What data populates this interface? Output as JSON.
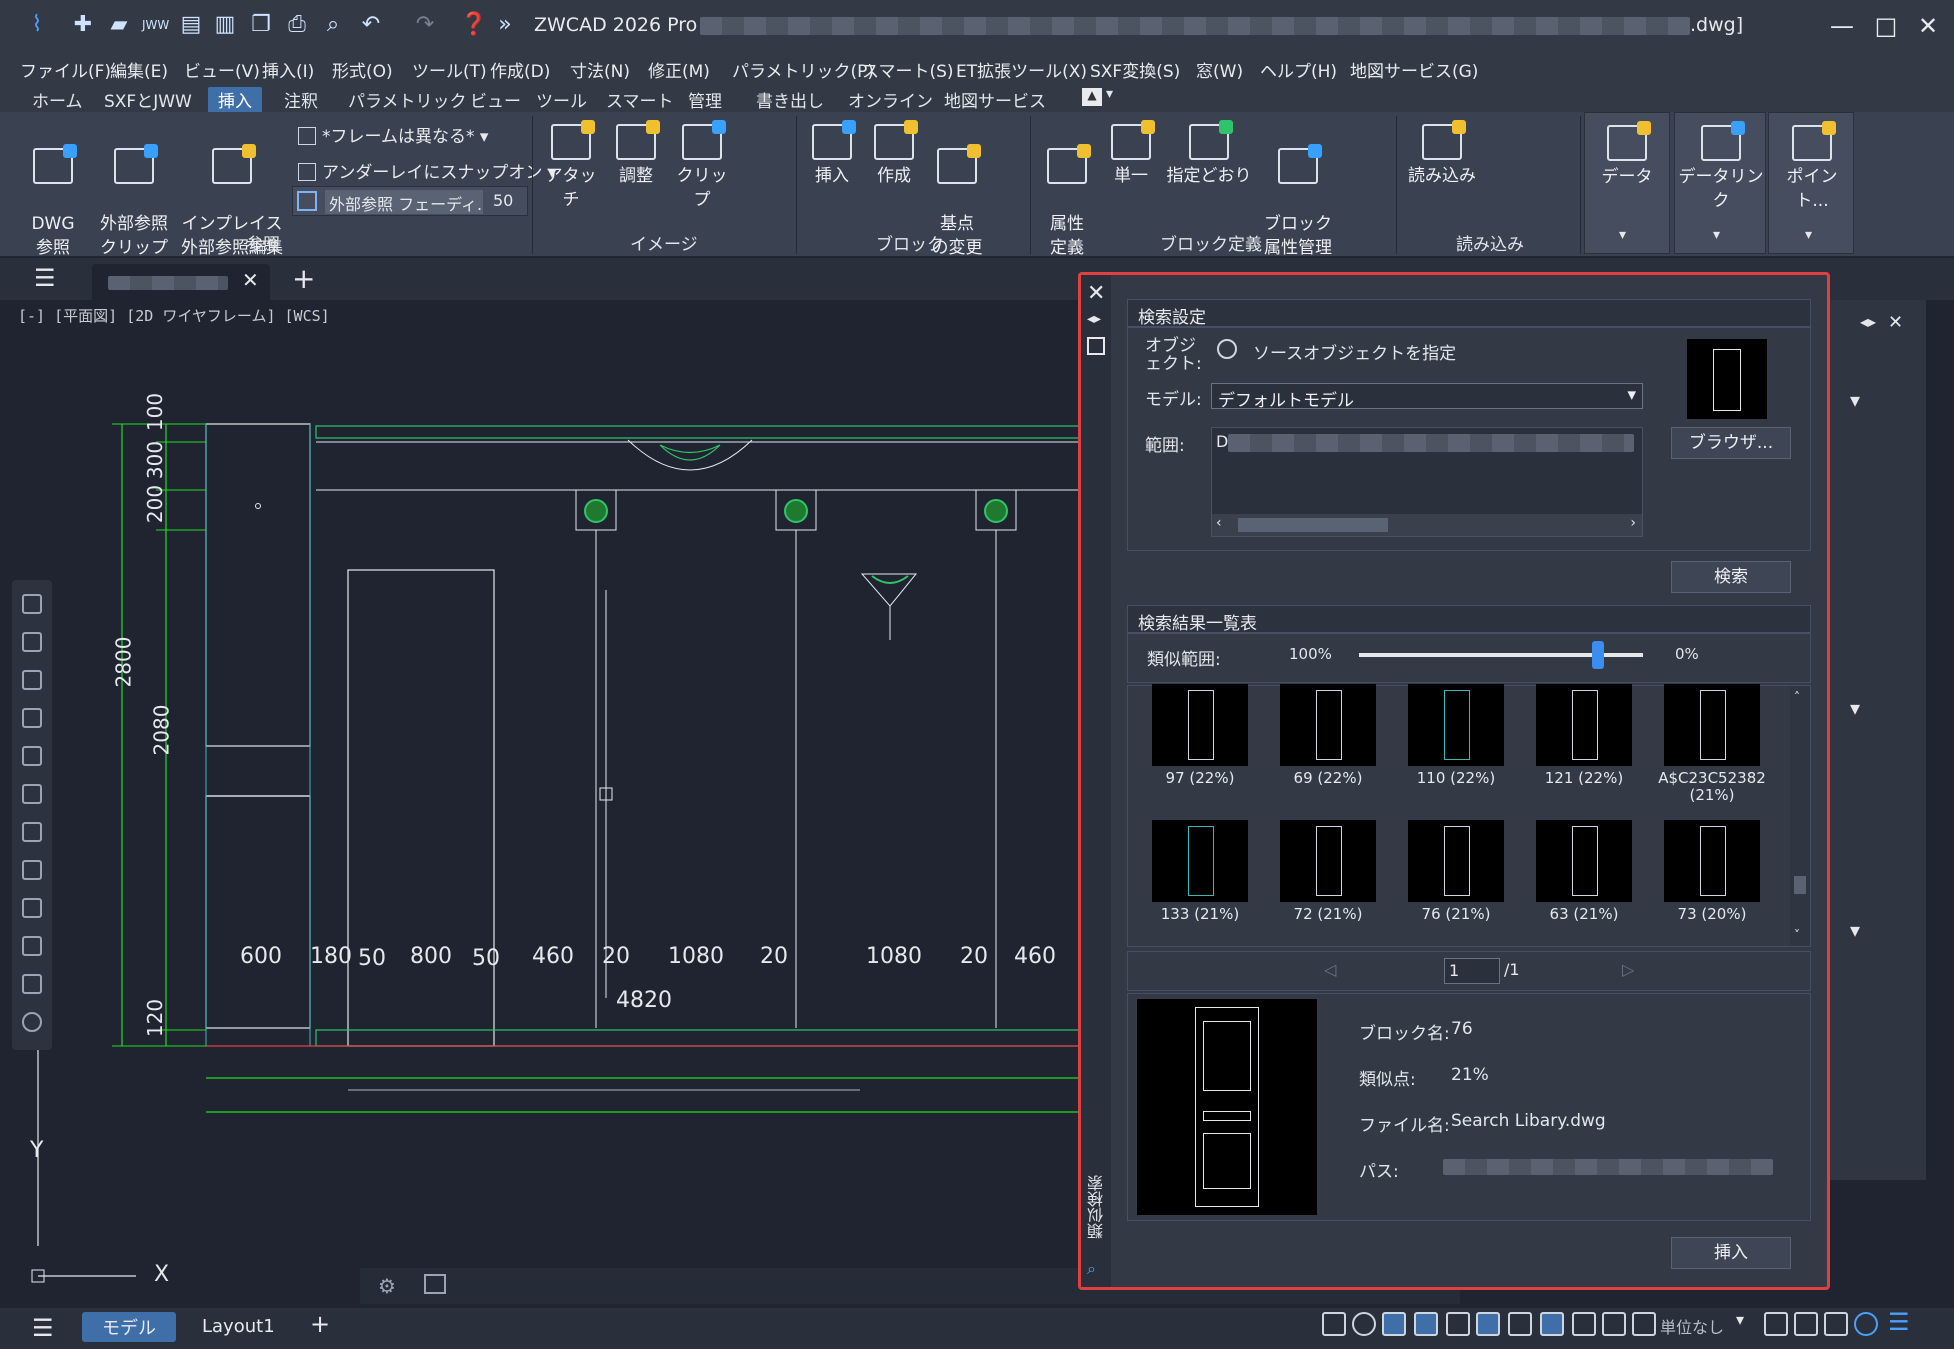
{
  "titlebar": {
    "app_title": "ZWCAD 2026 Pro - [",
    "file_suffix": ".dwg]",
    "minimize": "—",
    "maximize": "□",
    "close": "✕"
  },
  "menu": [
    "ファイル(F)",
    "編集(E)",
    "ビュー(V)",
    "挿入(I)",
    "形式(O)",
    "ツール(T)",
    "作成(D)",
    "寸法(N)",
    "修正(M)",
    "パラメトリック(P)",
    "スマート(S)",
    "ET拡張ツール(X)",
    "SXF変換(S)",
    "窓(W)",
    "ヘルプ(H)",
    "地図サービス(G)"
  ],
  "ribbon_tabs": [
    "ホーム",
    "SXFとJWW",
    "挿入",
    "注釈",
    "パラメトリック",
    "ビュー",
    "ツール",
    "スマート",
    "管理",
    "書き出し",
    "オンライン",
    "地図サービス"
  ],
  "ribbon_active_tab": "挿入",
  "ribbon": {
    "ref": {
      "dwg": "DWG\n参照",
      "xref_clip": "外部参照\nクリップ",
      "inplace_edit": "インプレイス\n外部参照編集",
      "frame_dropdown": "*フレームは異なる*",
      "underlay_snap": "アンダーレイにスナップオン",
      "xref_fade_label": "外部参照 フェーディ...",
      "xref_fade_value": "50",
      "panel_label": "参照"
    },
    "image": {
      "attach": "アタッチ",
      "adjust": "調整",
      "clip": "クリップ",
      "panel_label": "イメージ"
    },
    "block": {
      "insert": "挿入",
      "create": "作成",
      "basepoint": "基点\nの変更",
      "panel_label": "ブロック"
    },
    "block_def": {
      "attr_def": "属性\n定義",
      "single": "単一",
      "as_specified": "指定どおり",
      "block_attr_mgr": "ブロック\n属性管理",
      "panel_label": "ブロック定義"
    },
    "import": {
      "load": "読み込み",
      "panel_label": "読み込み"
    },
    "data": "データ",
    "data_link": "データリンク",
    "point": "ポイント..."
  },
  "viewport_label": "[-] [平面図] [2D ワイヤフレーム] [WCS]",
  "drawing": {
    "dim_vertical": [
      "100",
      "300",
      "200",
      "2800",
      "2080",
      "120"
    ],
    "dim_horizontal": [
      "600",
      "180",
      "50",
      "800",
      "50",
      "460",
      "20",
      "1080",
      "20",
      "1080",
      "20",
      "460"
    ],
    "total_width": "4820",
    "axis_y": "Y",
    "axis_x": "X"
  },
  "search_panel": {
    "vertical_title": "類似検索",
    "settings_header": "検索設定",
    "object_label": "オブジェクト:",
    "object_value": "ソースオブジェクトを指定",
    "model_label": "モデル:",
    "model_value": "デフォルトモデル",
    "range_label": "範囲:",
    "range_value": "D:",
    "browse_button": "ブラウザ...",
    "search_button": "検索",
    "results_header": "検索結果一覧表",
    "similarity_label": "類似範囲:",
    "similarity_max": "100%",
    "similarity_min": "0%",
    "similarity_value": 0.84,
    "results": [
      {
        "caption": "97 (22%)"
      },
      {
        "caption": "69 (22%)"
      },
      {
        "caption": "110 (22%)"
      },
      {
        "caption": "121 (22%)"
      },
      {
        "caption": "A$C23C52382\n(21%)"
      },
      {
        "caption": "133 (21%)"
      },
      {
        "caption": "72 (21%)"
      },
      {
        "caption": "76 (21%)"
      },
      {
        "caption": "63 (21%)"
      },
      {
        "caption": "73 (20%)"
      }
    ],
    "page_current": "1",
    "page_total": "/1",
    "detail": {
      "block_name_label": "ブロック名:",
      "block_name_value": "76",
      "similarity_label": "類似点:",
      "similarity_value": "21%",
      "file_label": "ファイル名:",
      "file_value": "Search Libary.dwg",
      "path_label": "パス:"
    },
    "insert_button": "挿入"
  },
  "layout_tabs": {
    "model": "モデル",
    "layout1": "Layout1",
    "add": "+"
  },
  "status": {
    "unit": "単位なし"
  },
  "colors": {
    "accent": "#3f6fa8",
    "panel_border": "#e04040",
    "dim_green": "#22dd22",
    "drawing_bg": "#1f2430"
  }
}
